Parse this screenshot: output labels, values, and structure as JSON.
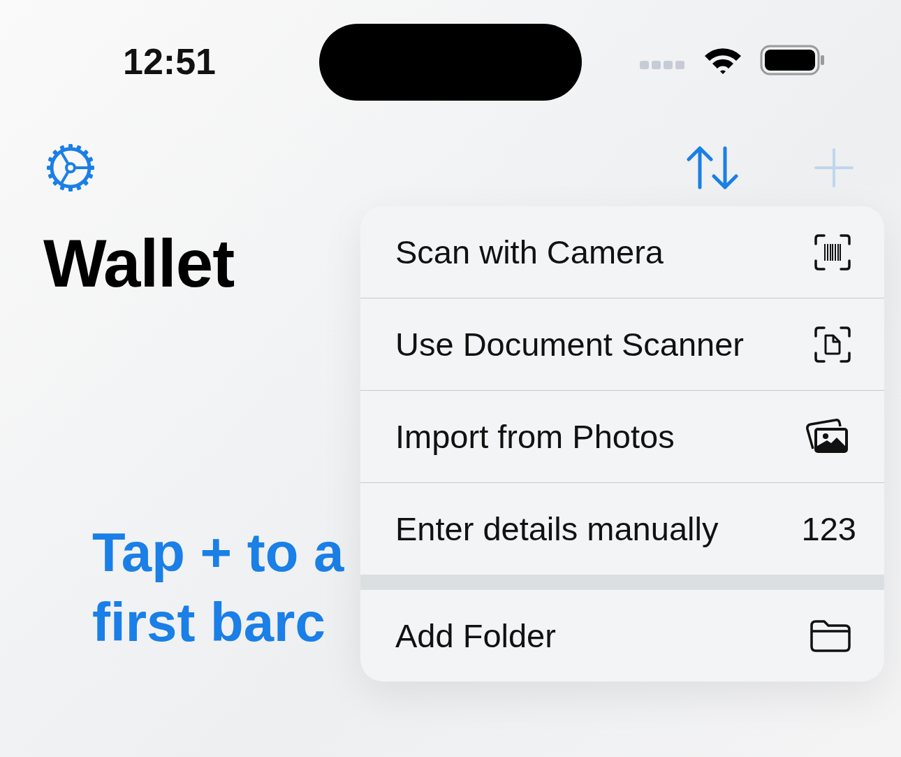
{
  "status_bar": {
    "time": "12:51"
  },
  "nav": {
    "add_disabled": true
  },
  "title": "Wallet",
  "empty_hint": [
    "Tap + to a",
    "first barc"
  ],
  "menu": {
    "groups": [
      {
        "items": [
          {
            "label": "Scan with Camera",
            "kind": "barcode"
          },
          {
            "label": "Use Document Scanner",
            "kind": "document"
          },
          {
            "label": "Import from Photos",
            "kind": "photos"
          },
          {
            "label": "Enter details manually",
            "kind": "text",
            "trailing": "123"
          }
        ]
      },
      {
        "items": [
          {
            "label": "Add Folder",
            "kind": "folder"
          }
        ]
      }
    ]
  }
}
